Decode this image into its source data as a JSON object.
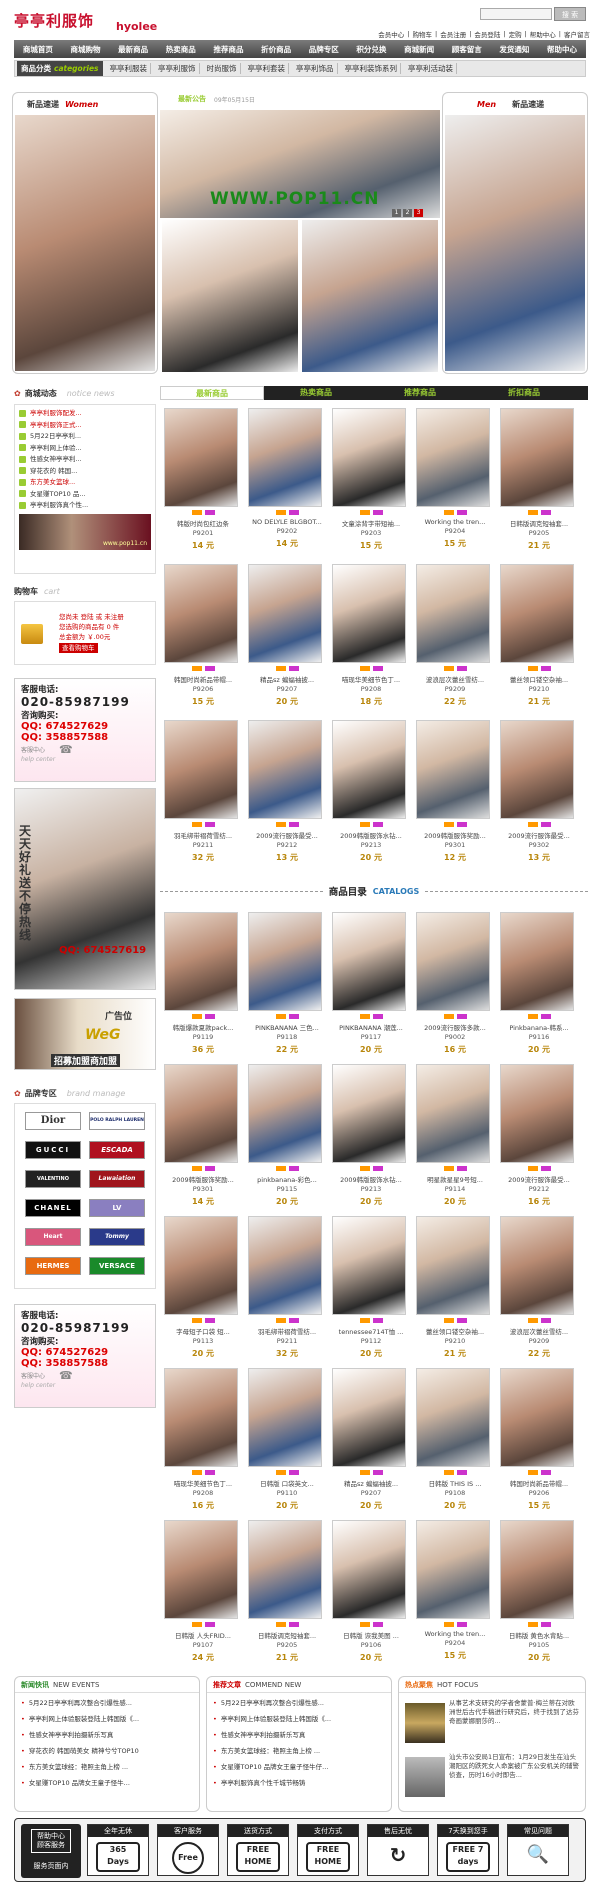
{
  "header": {
    "logo": "亭亭利服饰",
    "logo_en": "hyolee",
    "search_button": "搜 索",
    "top_links": [
      "会员中心",
      "|",
      "购物车",
      "|",
      "会员注册",
      "|",
      "会员登陆",
      "|",
      "定购",
      "|",
      "帮助中心",
      "|",
      "客户留言"
    ]
  },
  "main_nav": [
    "商城首页",
    "商城购物",
    "最新商品",
    "热卖商品",
    "推荐商品",
    "折价商品",
    "品牌专区",
    "积分兑换",
    "商城新闻",
    "顾客留言",
    "发货通知",
    "帮助中心"
  ],
  "sub_nav": {
    "label": "商品分类",
    "label_en": "categories",
    "items": [
      "亭亭利服装",
      "亭亭利服饰",
      "时尚服饰",
      "亭亭利套装",
      "亭亭利饰品",
      "亭亭利装饰系列",
      "亭亭利活动装"
    ]
  },
  "banner": {
    "women_label": "新品速递",
    "women_en": "Women",
    "men_label": "新品速递",
    "men_en": "Men",
    "notice_label": "最新公告",
    "notice_date": "09年05月15日",
    "watermark": "WWW.POP11.CN",
    "pager": [
      "1",
      "2",
      "3"
    ]
  },
  "news": {
    "title": "商城动态",
    "title_en": "notice news",
    "items": [
      "亭亭利服饰配发...",
      "亭亭利服饰正式...",
      "5月22日亭亭利...",
      "亭亭利网上体验...",
      "性感女神亭亭利...",
      "穿花衣的 韩国...",
      "东方美女篮球...",
      "女星赚TOP10 品...",
      "亭亭利服饰真个性..."
    ],
    "footer_banner": "www.pop11.cn"
  },
  "cart": {
    "title": "购物车",
    "title_en": "cart",
    "line1": "您尚未 登陆 或 未注册",
    "line2": "您选购的商品有 0 件",
    "line3": "总金额为 ￥.00元",
    "button": "查看购物车"
  },
  "service": {
    "phone_label": "客服电话:",
    "phone": "020-85987199",
    "qq_label": "咨询购买:",
    "qq1": "QQ: 674527629",
    "qq2": "QQ: 358857588",
    "footer": "客服中心",
    "footer_en": "help center"
  },
  "promo": {
    "vertical_text": "天天好礼送不停热线",
    "qq": "QQ: 674527619"
  },
  "ad": {
    "label": "广告位",
    "slogan": "招募加盟商加盟"
  },
  "brands": {
    "title": "品牌专区",
    "title_en": "brand manage",
    "items": [
      "Dior",
      "POLO RALPH LAUREN",
      "GUCCI",
      "ESCADA",
      "VALENTINO",
      "Lawaiation",
      "CHANEL",
      "LV",
      "Heart",
      "Tommy",
      "HERMES",
      "VERSACE"
    ]
  },
  "tabs": [
    "最新商品",
    "热卖商品",
    "推荐商品",
    "折扣商品"
  ],
  "products_top": [
    {
      "name": "韩版时尚包红边条",
      "code": "P9201",
      "price": "14 元"
    },
    {
      "name": "NO DELYLE BLGBOT...",
      "code": "P9202",
      "price": "14 元"
    },
    {
      "name": "文童涂背字带短袖...",
      "code": "P9203",
      "price": "15 元"
    },
    {
      "name": "Working the tren...",
      "code": "P9204",
      "price": "15 元"
    },
    {
      "name": "日韩版调克短袖套...",
      "code": "P9205",
      "price": "21 元"
    },
    {
      "name": "韩国时尚新品带帽...",
      "code": "P9206",
      "price": "15 元"
    },
    {
      "name": "精品sz 蝙蝠袖披...",
      "code": "P9207",
      "price": "20 元"
    },
    {
      "name": "喵现华美细节色丁...",
      "code": "P9208",
      "price": "18 元"
    },
    {
      "name": "波浪层次蕾丝雪纺...",
      "code": "P9209",
      "price": "22 元"
    },
    {
      "name": "蕾丝领口镂空杂袖...",
      "code": "P9210",
      "price": "21 元"
    },
    {
      "name": "羽毛绑带褶荷雪纺...",
      "code": "P9211",
      "price": "32 元"
    },
    {
      "name": "2009流行服饰最受...",
      "code": "P9212",
      "price": "13 元"
    },
    {
      "name": "2009韩版服饰水钻...",
      "code": "P9213",
      "price": "20 元"
    },
    {
      "name": "2009韩版服饰奖励...",
      "code": "P9301",
      "price": "12 元"
    },
    {
      "name": "2009流行服饰最受...",
      "code": "P9302",
      "price": "13 元"
    }
  ],
  "catalog": {
    "title": "商品目录",
    "title_en": "CATALOGS"
  },
  "products_catalog": [
    {
      "name": "韩版爆款夏款pack...",
      "code": "P9119",
      "price": "36 元"
    },
    {
      "name": "PINKBANANA 三色...",
      "code": "P9118",
      "price": "22 元"
    },
    {
      "name": "PINKBANANA 潮莲...",
      "code": "P9117",
      "price": "20 元"
    },
    {
      "name": "2009流行服饰多款...",
      "code": "P9002",
      "price": "16 元"
    },
    {
      "name": "Pinkbanana-韩系...",
      "code": "P9116",
      "price": "20 元"
    },
    {
      "name": "2009韩版服饰奖励...",
      "code": "P9301",
      "price": "14 元"
    },
    {
      "name": "pinkbanana-彩色...",
      "code": "P9115",
      "price": "20 元"
    },
    {
      "name": "2009韩版服饰水钻...",
      "code": "P9213",
      "price": "20 元"
    },
    {
      "name": "明星款星星9号短...",
      "code": "P9114",
      "price": "20 元"
    },
    {
      "name": "2009流行服饰最受...",
      "code": "P9212",
      "price": "16 元"
    },
    {
      "name": "字母短子口袋 短...",
      "code": "P9113",
      "price": "20 元"
    },
    {
      "name": "羽毛绑带褶荷雪纺...",
      "code": "P9211",
      "price": "32 元"
    },
    {
      "name": "tennessee714T恤 ...",
      "code": "P9112",
      "price": "20 元"
    },
    {
      "name": "蕾丝领口镂空杂袖...",
      "code": "P9210",
      "price": "21 元"
    },
    {
      "name": "波浪层次蕾丝雪纺...",
      "code": "P9209",
      "price": "22 元"
    },
    {
      "name": "喵现华美细节色丁...",
      "code": "P9208",
      "price": "16 元"
    },
    {
      "name": "日韩版 口袋英文...",
      "code": "P9110",
      "price": "20 元"
    },
    {
      "name": "精品sz 蝙蝠袖披...",
      "code": "P9207",
      "price": "20 元"
    },
    {
      "name": "日韩版 THIS IS ...",
      "code": "P9108",
      "price": "20 元"
    },
    {
      "name": "韩国时尚新品带帽...",
      "code": "P9206",
      "price": "15 元"
    },
    {
      "name": "日韩版 人头FRID...",
      "code": "P9107",
      "price": "24 元"
    },
    {
      "name": "日韩版调克短袖套...",
      "code": "P9205",
      "price": "21 元"
    },
    {
      "name": "日韩版 诙我美图 ...",
      "code": "P9106",
      "price": "20 元"
    },
    {
      "name": "Working the tren...",
      "code": "P9204",
      "price": "15 元"
    },
    {
      "name": "日韩版 黄色水背貼...",
      "code": "P9105",
      "price": "20 元"
    }
  ],
  "bottom": {
    "news_title": "新闻快讯",
    "news_en": "NEW EVENTS",
    "news_items": [
      "5月22日亭亭利再次整合引爆性感...",
      "亭亭利网上体验服装登陆上韩国版《...",
      "性感女神亭亭利拍摄新乐写真",
      "穿花衣的 韩国萌美女 精神兮兮TOP10",
      "东方美女篮球经：艳照主角上榜 ...",
      "女星赚TOP10 品牌女王童子怪牛..."
    ],
    "rec_title": "推荐文章",
    "rec_en": "COMMEND NEW",
    "rec_items": [
      "5月22日亭亭利再次整合引爆性感...",
      "亭亭利网上体验服装登陆上韩国版《...",
      "性感女神亭亭利拍摄新乐写真",
      "东方美女篮球经：艳照主角上榜 ...",
      "女星赚TOP10 品牌女王童子怪牛仔...",
      "亭亭利服饰真个性千城节畅铸"
    ],
    "hot_title": "热点聚焦",
    "hot_en": "HOT FOCUS",
    "hot1": "从事艺术支研究的学者舍蒙普·梅兰蒂在对欧洲世后古代手稿进行研究后，终于找到了达芬奇画蒙娜丽莎的...",
    "hot2": "汕头市公安局1日宣布：1月29日发生在汕头潮阳区的跌死女人命案被广东公安机关的辅警侦查，历时16小时即告..."
  },
  "services": {
    "center_l1": "帮助中心",
    "center_l2": "顾客服务",
    "center_btn": "服务页面内",
    "items": [
      {
        "title": "全年无休",
        "icon": "365 Days"
      },
      {
        "title": "客户服务",
        "icon": "Free"
      },
      {
        "title": "送货方式",
        "icon": "FREE HOME"
      },
      {
        "title": "支付方式",
        "icon": "FREE HOME"
      },
      {
        "title": "售后无忧",
        "icon": "↻"
      },
      {
        "title": "7天换到您手",
        "icon": "FREE 7 days"
      },
      {
        "title": "常见问题",
        "icon": "🔍"
      }
    ]
  }
}
